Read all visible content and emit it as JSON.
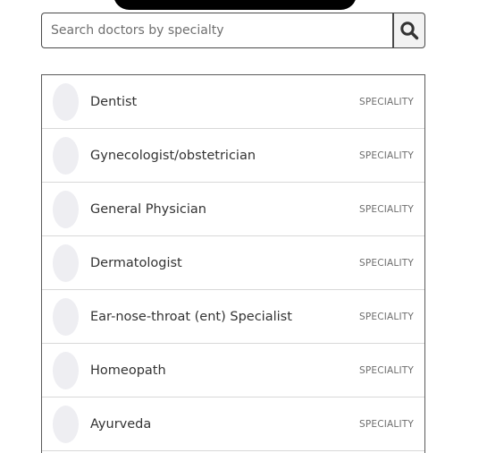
{
  "search": {
    "placeholder": "Search doctors by specialty",
    "value": ""
  },
  "icons": {
    "search_button_icon": "search-icon"
  },
  "specialties": [
    {
      "name": "Dentist",
      "tag": "SPECIALITY"
    },
    {
      "name": "Gynecologist/obstetrician",
      "tag": "SPECIALITY"
    },
    {
      "name": "General Physician",
      "tag": "SPECIALITY"
    },
    {
      "name": "Dermatologist",
      "tag": "SPECIALITY"
    },
    {
      "name": "Ear-nose-throat (ent) Specialist",
      "tag": "SPECIALITY"
    },
    {
      "name": "Homeopath",
      "tag": "SPECIALITY"
    },
    {
      "name": "Ayurveda",
      "tag": "SPECIALITY"
    }
  ],
  "colors": {
    "top_bar": "#000000",
    "avatar_placeholder": "#eeeef2",
    "border": "#4a4a4a"
  }
}
